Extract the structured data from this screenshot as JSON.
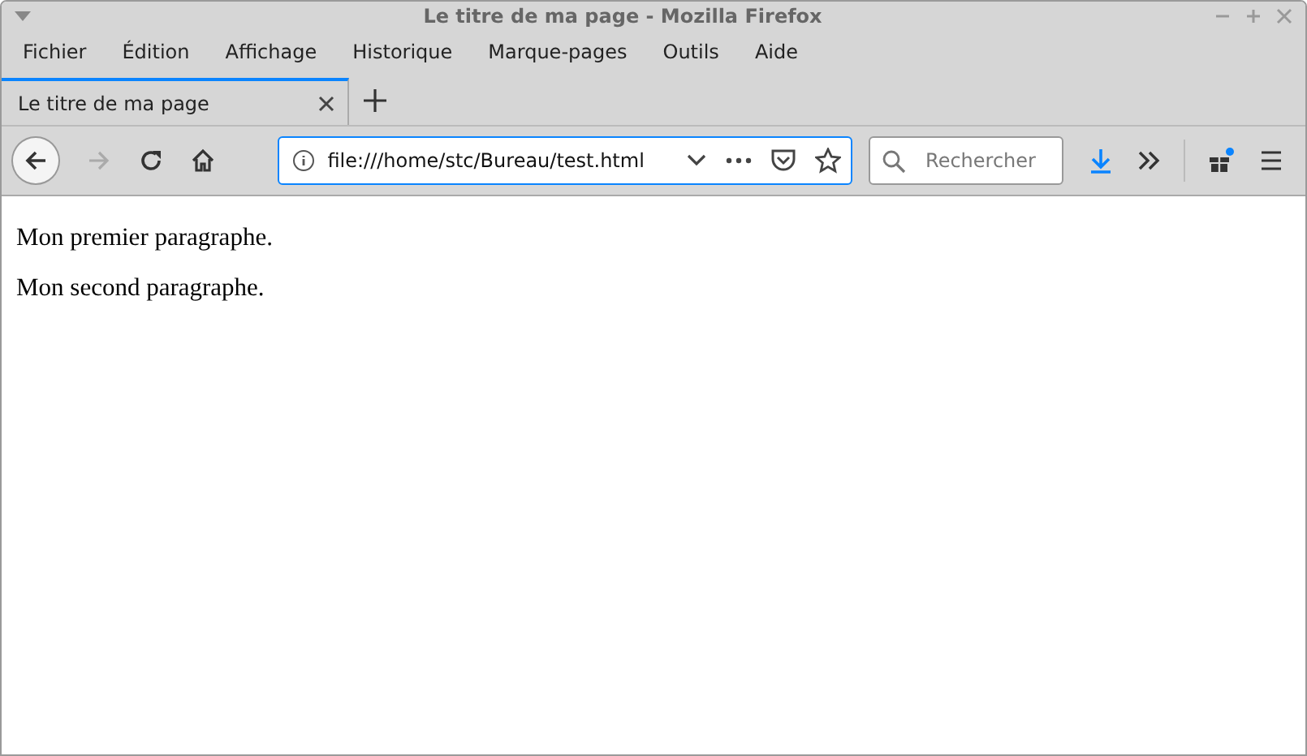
{
  "window": {
    "title": "Le titre de ma page - Mozilla Firefox"
  },
  "menu": [
    "Fichier",
    "Édition",
    "Affichage",
    "Historique",
    "Marque-pages",
    "Outils",
    "Aide"
  ],
  "tabs": [
    {
      "label": "Le titre de ma page",
      "selected": true
    }
  ],
  "address_bar": {
    "value": "file:///home/stc/Bureau/test.html"
  },
  "search": {
    "placeholder": "Rechercher"
  },
  "page": {
    "paragraphs": [
      "Mon premier paragraphe.",
      "Mon second paragraphe."
    ]
  }
}
